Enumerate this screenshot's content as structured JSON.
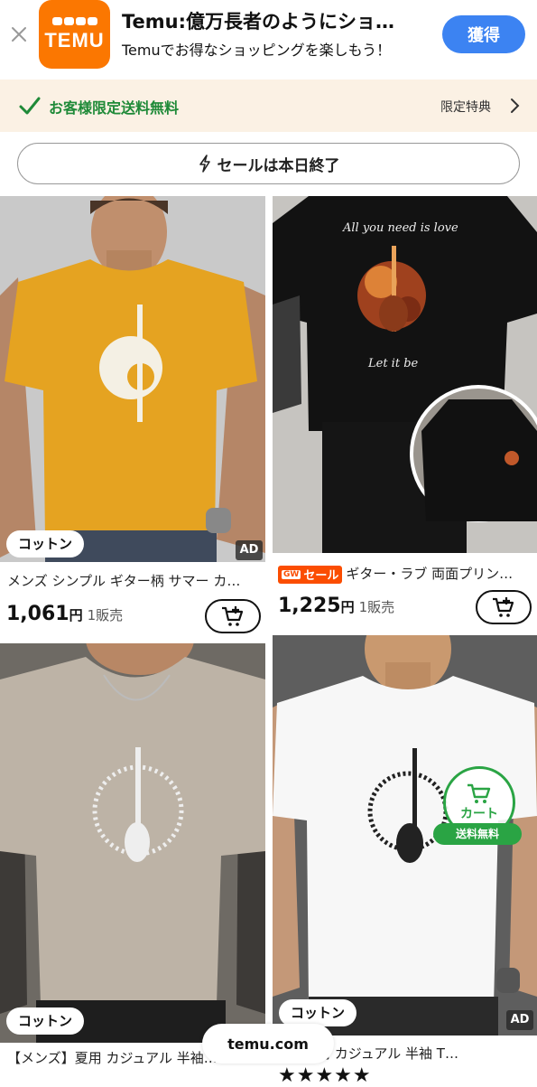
{
  "app_banner": {
    "logo_text": "TEMU",
    "title": "Temu:億万長者のようにショ…",
    "subtitle": "Temuでお得なショッピングを楽しもう！",
    "get_button": "獲得",
    "brand_color": "#fb7701",
    "button_color": "#3c83f2"
  },
  "shipping_bar": {
    "text": "お客様限定送料無料",
    "perk_link": "限定特典",
    "text_color": "#1f8a38"
  },
  "sale_pill": {
    "text": "セールは本日終了"
  },
  "products": [
    {
      "badge": "コットン",
      "ad": "AD",
      "title": "メンズ シンプル ギター柄 サマー カ…",
      "price": "1,061",
      "yen": "円",
      "sold": "1販売",
      "shirt_color": "#e5a321",
      "print_text": ""
    },
    {
      "sale_label": "セール",
      "gw": "GW",
      "title": "ギター・ラブ 両面プリン…",
      "price": "1,225",
      "yen": "円",
      "sold": "1販売",
      "shirt_color": "#121212",
      "print_text_top": "All you need is love",
      "print_text_bottom": "Let it be"
    },
    {
      "badge": "コットン",
      "title": "【メンズ】夏用 カジュアル 半袖…",
      "shirt_color": "#bdb3a6"
    },
    {
      "badge": "コットン",
      "ad": "AD",
      "title": "…】夏用 カジュアル 半袖 T…",
      "shirt_color": "#f7f7f7"
    }
  ],
  "floating_cart": {
    "label": "カート",
    "free_shipping": "送料無料",
    "color": "#2aa444"
  },
  "domain": "temu.com",
  "rating_stars": "★★★★★"
}
